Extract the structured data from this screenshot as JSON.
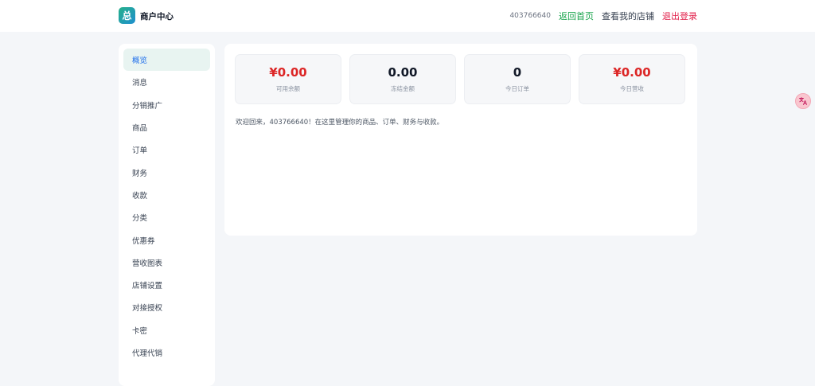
{
  "header": {
    "logo_text": "总",
    "brand": "商户中心",
    "user_id": "403766640",
    "nav_home": "返回首页",
    "nav_shop": "查看我的店铺",
    "nav_logout": "退出登录"
  },
  "sidebar": {
    "items": [
      {
        "label": "概览",
        "active": true
      },
      {
        "label": "消息"
      },
      {
        "label": "分销推广"
      },
      {
        "label": "商品"
      },
      {
        "label": "订单"
      },
      {
        "label": "财务"
      },
      {
        "label": "收款"
      },
      {
        "label": "分类"
      },
      {
        "label": "优惠券"
      },
      {
        "label": "营收图表"
      },
      {
        "label": "店铺设置"
      },
      {
        "label": "对接授权"
      },
      {
        "label": "卡密"
      },
      {
        "label": "代理代销"
      }
    ]
  },
  "stats": [
    {
      "value": "¥0.00",
      "label": "可用余额",
      "color": "#dc2626"
    },
    {
      "value": "0.00",
      "label": "冻结金额",
      "color": "#111827"
    },
    {
      "value": "0",
      "label": "今日订单",
      "color": "#111827"
    },
    {
      "value": "¥0.00",
      "label": "今日营收",
      "color": "#dc2626"
    }
  ],
  "welcome": "欢迎回来，403766640！在这里管理你的商品、订单、财务与收款。",
  "floating_button_icon": "translate-icon"
}
